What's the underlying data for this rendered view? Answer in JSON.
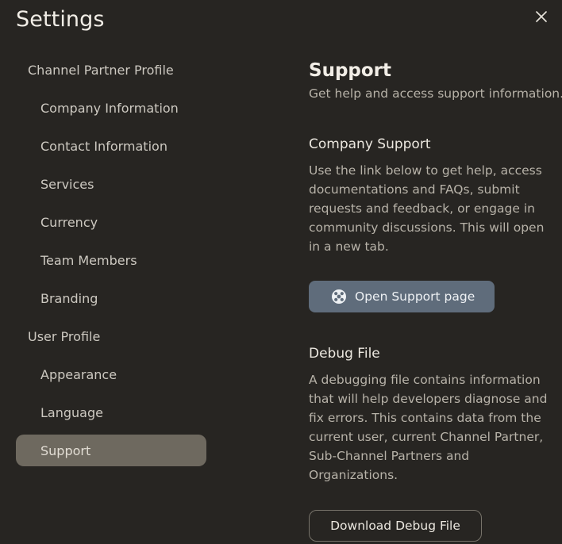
{
  "dialog": {
    "title": "Settings"
  },
  "sidebar": {
    "items": [
      {
        "label": "Channel Partner Profile",
        "level": "group"
      },
      {
        "label": "Company Information",
        "level": "child"
      },
      {
        "label": "Contact Information",
        "level": "child"
      },
      {
        "label": "Services",
        "level": "child"
      },
      {
        "label": "Currency",
        "level": "child"
      },
      {
        "label": "Team Members",
        "level": "child"
      },
      {
        "label": "Branding",
        "level": "child"
      },
      {
        "label": "User Profile",
        "level": "group"
      },
      {
        "label": "Appearance",
        "level": "child"
      },
      {
        "label": "Language",
        "level": "child"
      },
      {
        "label": "Support",
        "level": "child",
        "active": true
      }
    ]
  },
  "content": {
    "title": "Support",
    "subtitle": "Get help and access support information.",
    "company_support": {
      "title": "Company Support",
      "body": "Use the link below to get help, access documentations and FAQs, submit requests and feedback, or engage in community discussions. This will open in a new tab.",
      "button_label": "Open Support page",
      "button_icon": "lifebuoy-icon"
    },
    "debug_file": {
      "title": "Debug File",
      "body": "A debugging file contains information that will help developers diagnose and fix errors. This contains data from the current user, current Channel Partner, Sub-Channel Partners and Organizations.",
      "button_label": "Download Debug File"
    }
  },
  "colors": {
    "background": "#272522",
    "active_nav": "#6e695f",
    "support_button": "#5f6c7b"
  }
}
